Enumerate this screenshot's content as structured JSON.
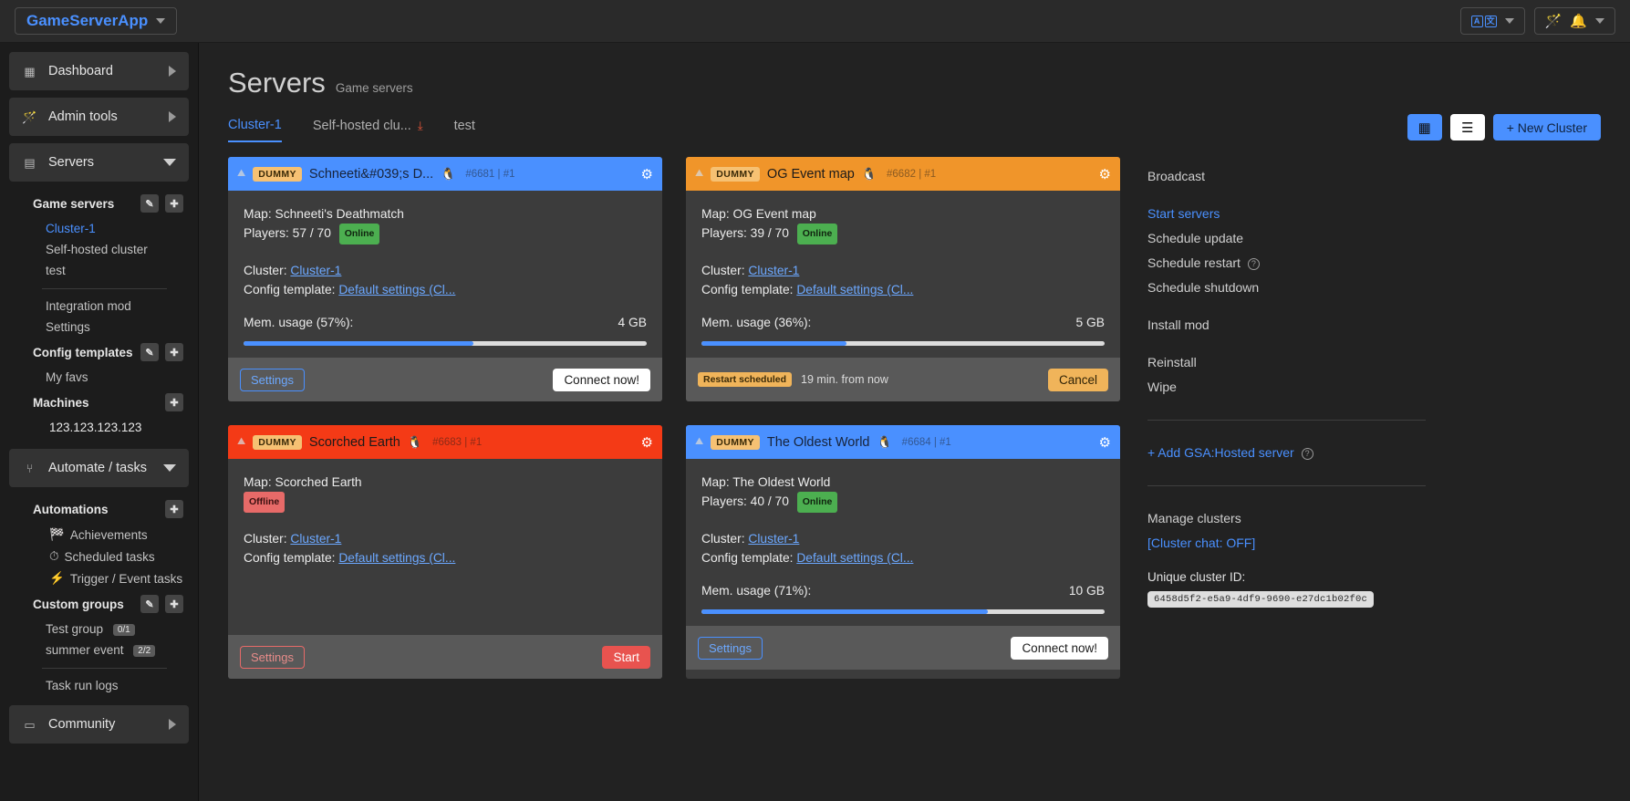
{
  "topbar": {
    "brand": "GameServerApp",
    "lang_a": "A",
    "lang_b": "文",
    "wand_icon": "magic-wand-icon",
    "bell_icon": "bell-icon"
  },
  "sidebar": {
    "nav": [
      {
        "label": "Dashboard",
        "icon": "grid-icon",
        "state": "collapsed"
      },
      {
        "label": "Admin tools",
        "icon": "magic-wand-icon",
        "state": "collapsed"
      },
      {
        "label": "Servers",
        "icon": "server-stack-icon",
        "state": "expanded"
      }
    ],
    "servers_section": {
      "heading": "Game servers",
      "items": [
        {
          "label": "Cluster-1",
          "active": true
        },
        {
          "label": "Self-hosted cluster",
          "active": false
        },
        {
          "label": "test",
          "active": false
        }
      ],
      "extra": [
        {
          "label": "Integration mod"
        },
        {
          "label": "Settings"
        }
      ]
    },
    "config_templates": {
      "heading": "Config templates",
      "items": [
        {
          "label": "My favs"
        }
      ]
    },
    "machines": {
      "heading": "Machines",
      "items": [
        {
          "label": "123.123.123.123"
        }
      ]
    },
    "automate": {
      "label": "Automate / tasks",
      "icon": "branch-icon",
      "automations_heading": "Automations",
      "automations": [
        {
          "label": "Achievements",
          "emoji": "🏁"
        },
        {
          "label": "Scheduled tasks",
          "emoji": "⏱"
        },
        {
          "label": "Trigger / Event tasks",
          "emoji": "⚡"
        }
      ],
      "custom_groups_heading": "Custom groups",
      "custom_groups": [
        {
          "label": "Test group",
          "count": "0/1"
        },
        {
          "label": "summer event",
          "count": "2/2"
        }
      ],
      "task_logs": "Task run logs"
    },
    "community": {
      "label": "Community",
      "icon": "window-icon",
      "state": "collapsed"
    }
  },
  "header": {
    "title": "Servers",
    "subtitle": "Game servers",
    "grid_view_icon": "grid-view-icon",
    "list_view_icon": "list-view-icon",
    "new_cluster": "+ New Cluster"
  },
  "tabs": [
    {
      "label": "Cluster-1",
      "active": true,
      "icon": null
    },
    {
      "label": "Self-hosted clu...",
      "active": false,
      "icon": "download-icon"
    },
    {
      "label": "test",
      "active": false,
      "icon": null
    }
  ],
  "cards": [
    {
      "header_color": "#4a90ff",
      "header_class": "blue",
      "tag": "DUMMY",
      "title": "Schneeti&#039;s D...",
      "os_icon": "linux-tux-icon",
      "ids": "#6681 | #1",
      "gear_icon": "gear-icon",
      "map_line": "Map: Schneeti's Deathmatch",
      "players_line": "Players: 57 / 70",
      "status": "Online",
      "status_kind": "online",
      "cluster_label": "Cluster:",
      "cluster_link": "Cluster-1",
      "template_label": "Config template:",
      "template_link": "Default settings (Cl...",
      "mem_label": "Mem. usage (57%):",
      "mem_value": "4 GB",
      "mem_pct": 57,
      "settings_label": "Settings",
      "settings_kind": "blue",
      "action_label": "Connect now!",
      "action_kind": "white",
      "schedule_tag": null,
      "schedule_text": null
    },
    {
      "header_color": "#f0952a",
      "header_class": "orange",
      "tag": "DUMMY",
      "title": "OG Event map",
      "os_icon": "linux-tux-icon",
      "ids": "#6682 | #1",
      "gear_icon": "gear-icon",
      "map_line": "Map: OG Event map",
      "players_line": "Players: 39 / 70",
      "status": "Online",
      "status_kind": "online",
      "cluster_label": "Cluster:",
      "cluster_link": "Cluster-1",
      "template_label": "Config template:",
      "template_link": "Default settings (Cl...",
      "mem_label": "Mem. usage (36%):",
      "mem_value": "5 GB",
      "mem_pct": 36,
      "settings_label": null,
      "settings_kind": null,
      "action_label": "Cancel",
      "action_kind": "orange",
      "schedule_tag": "Restart scheduled",
      "schedule_text": "19 min. from now"
    },
    {
      "header_color": "#f43a16",
      "header_class": "red",
      "tag": "DUMMY",
      "title": "Scorched Earth",
      "os_icon": "linux-tux-icon",
      "ids": "#6683 | #1",
      "gear_icon": "gear-icon",
      "map_line": "Map: Scorched Earth",
      "players_line": null,
      "status": "Offline",
      "status_kind": "offline",
      "cluster_label": "Cluster:",
      "cluster_link": "Cluster-1",
      "template_label": "Config template:",
      "template_link": "Default settings (Cl...",
      "mem_label": null,
      "mem_value": null,
      "mem_pct": 0,
      "settings_label": "Settings",
      "settings_kind": "red",
      "action_label": "Start",
      "action_kind": "red",
      "schedule_tag": null,
      "schedule_text": null
    },
    {
      "header_color": "#4a90ff",
      "header_class": "blue",
      "tag": "DUMMY",
      "title": "The Oldest World",
      "os_icon": "linux-tux-icon",
      "ids": "#6684 | #1",
      "gear_icon": "gear-icon",
      "map_line": "Map: The Oldest World",
      "players_line": "Players: 40 / 70",
      "status": "Online",
      "status_kind": "online",
      "cluster_label": "Cluster:",
      "cluster_link": "Cluster-1",
      "template_label": "Config template:",
      "template_link": "Default settings (Cl...",
      "mem_label": "Mem. usage (71%):",
      "mem_value": "10 GB",
      "mem_pct": 71,
      "settings_label": "Settings",
      "settings_kind": "blue",
      "action_label": "Connect now!",
      "action_kind": "white",
      "schedule_tag": null,
      "schedule_text": null
    }
  ],
  "right_panel": {
    "broadcast": "Broadcast",
    "start_servers": "Start servers",
    "schedule_update": "Schedule update",
    "schedule_restart": "Schedule restart",
    "schedule_shutdown": "Schedule shutdown",
    "install_mod": "Install mod",
    "reinstall": "Reinstall",
    "wipe": "Wipe",
    "add_hosted": "+ Add GSA:Hosted server",
    "manage_clusters": "Manage clusters",
    "cluster_chat": "[Cluster chat: OFF]",
    "uid_label": "Unique cluster ID:",
    "uid_value": "6458d5f2-e5a9-4df9-9690-e27dc1b02f0c"
  }
}
